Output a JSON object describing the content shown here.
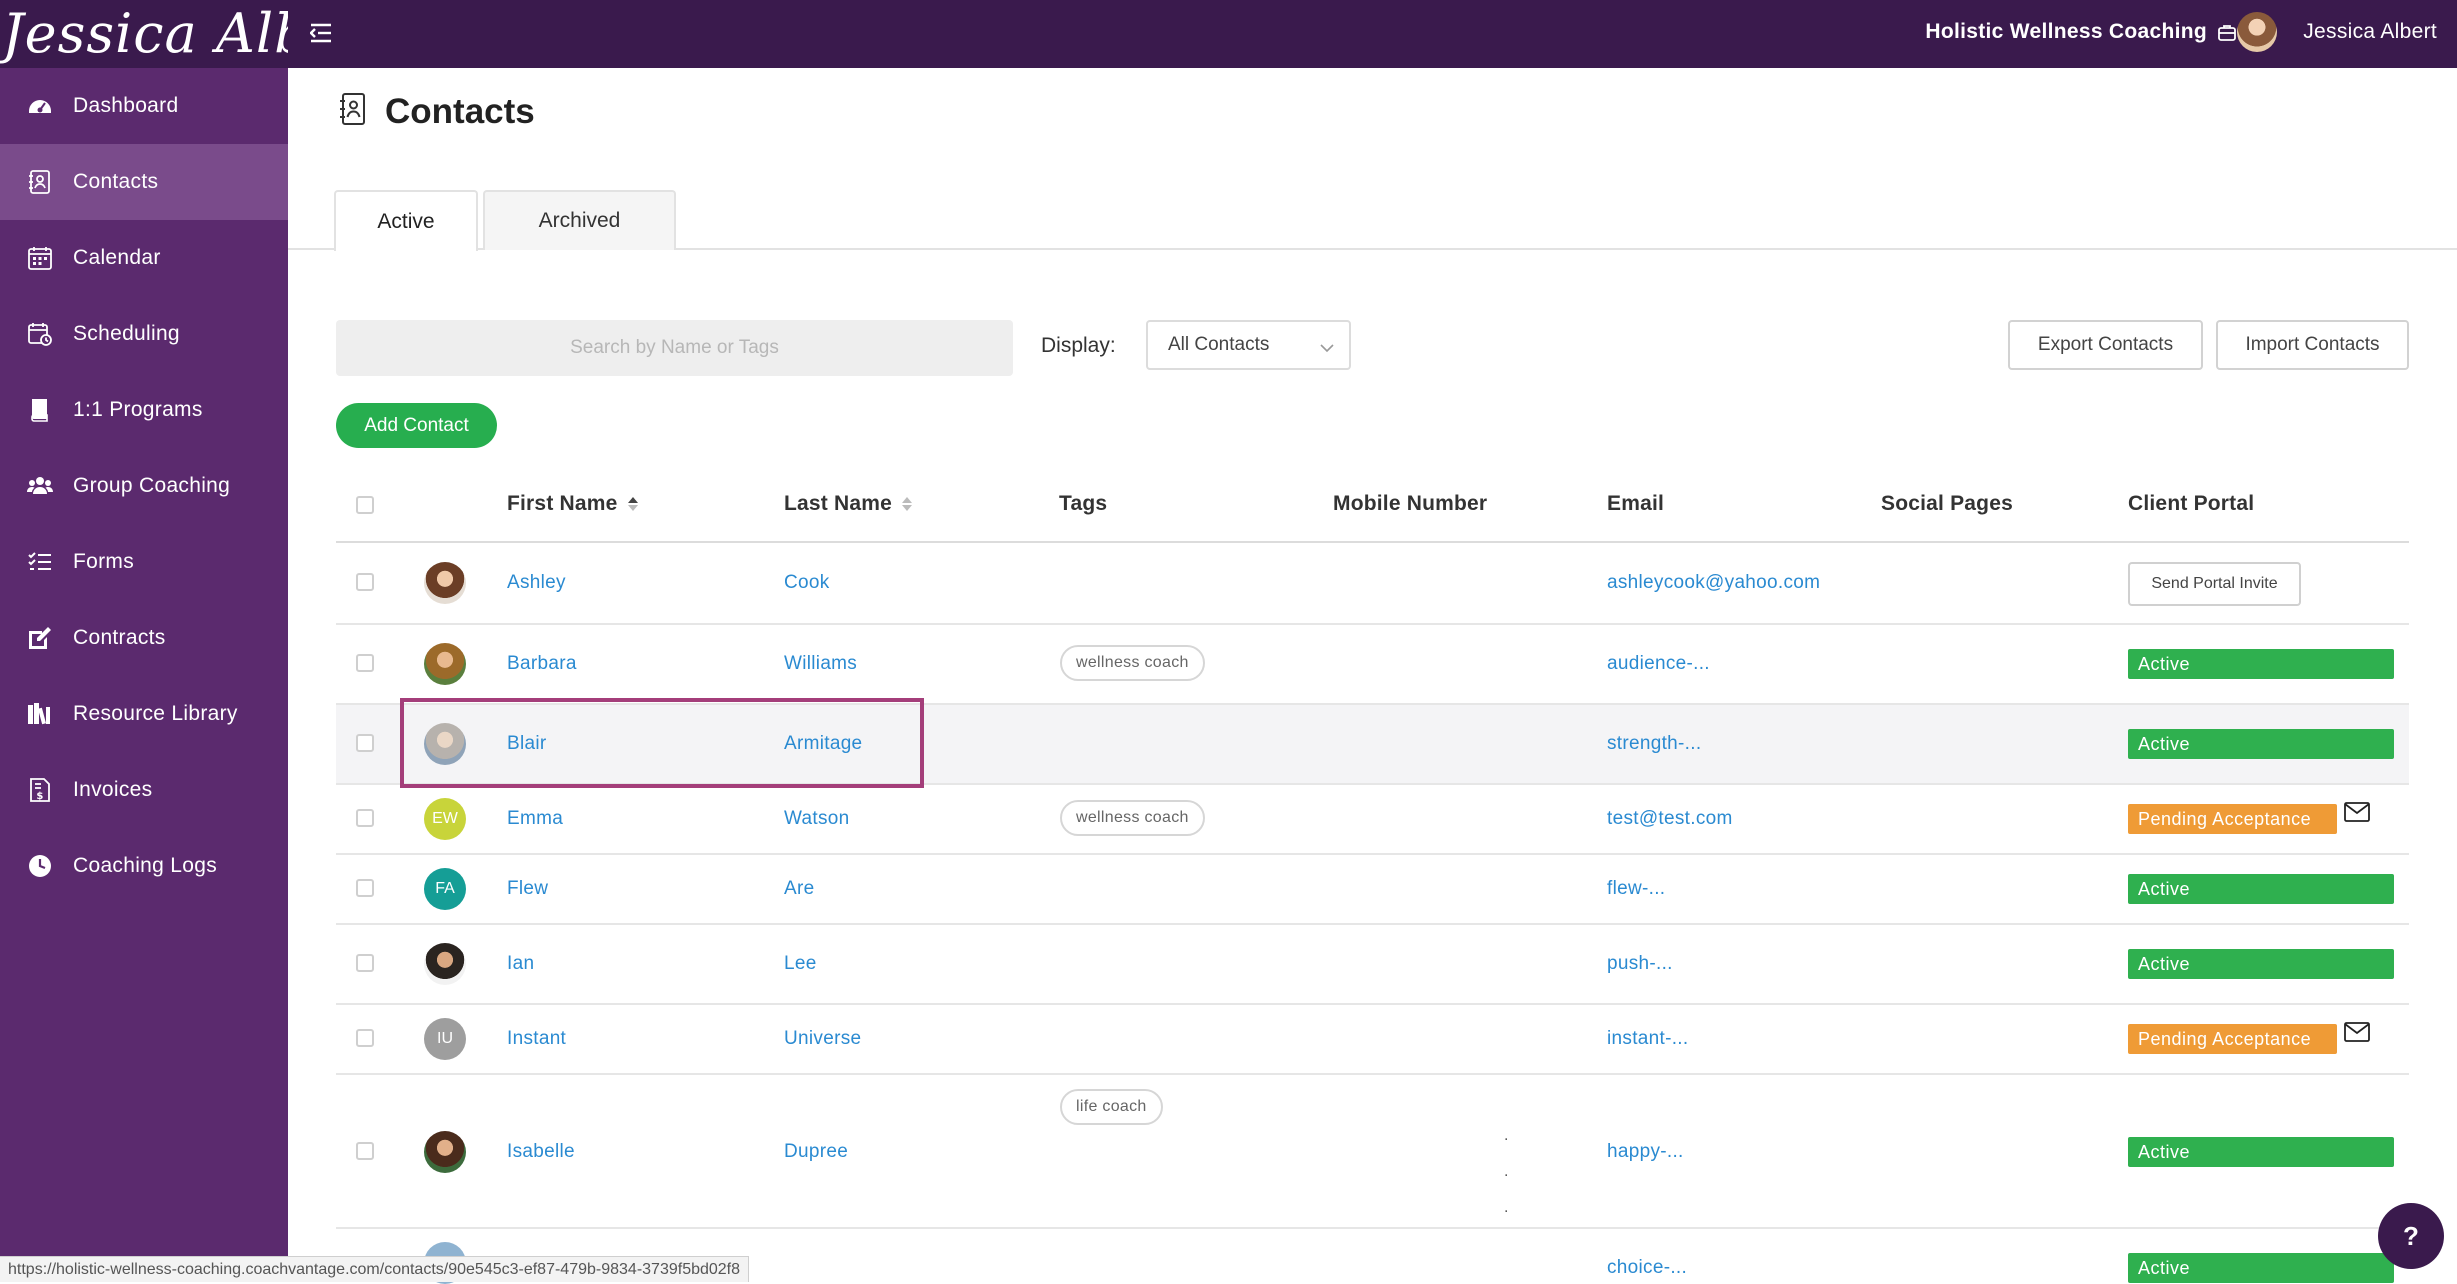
{
  "header": {
    "logo_text": "Jessica Albert",
    "business_name": "Holistic Wellness Coaching",
    "user_name": "Jessica Albert"
  },
  "sidebar": {
    "items": [
      {
        "label": "Dashboard",
        "icon": "dashboard-icon"
      },
      {
        "label": "Contacts",
        "icon": "contacts-icon",
        "active": true
      },
      {
        "label": "Calendar",
        "icon": "calendar-icon"
      },
      {
        "label": "Scheduling",
        "icon": "scheduling-icon"
      },
      {
        "label": "1:1 Programs",
        "icon": "programs-icon"
      },
      {
        "label": "Group Coaching",
        "icon": "group-icon"
      },
      {
        "label": "Forms",
        "icon": "forms-icon"
      },
      {
        "label": "Contracts",
        "icon": "contracts-icon"
      },
      {
        "label": "Resource Library",
        "icon": "library-icon"
      },
      {
        "label": "Invoices",
        "icon": "invoices-icon"
      },
      {
        "label": "Coaching Logs",
        "icon": "clock-icon"
      }
    ]
  },
  "page": {
    "title": "Contacts",
    "tabs": [
      "Active",
      "Archived"
    ],
    "search_placeholder": "Search by Name or Tags",
    "display_label": "Display:",
    "display_value": "All Contacts",
    "export_label": "Export Contacts",
    "import_label": "Import Contacts",
    "add_label": "Add Contact"
  },
  "table": {
    "columns": [
      "First Name",
      "Last Name",
      "Tags",
      "Mobile Number",
      "Email",
      "Social Pages",
      "Client Portal"
    ],
    "rows": [
      {
        "first": "Ashley",
        "last": "Cook",
        "tag": "",
        "email": "ashleycook@yahoo.com",
        "portal": "Send Portal Invite",
        "initials": ""
      },
      {
        "first": "Barbara",
        "last": "Williams",
        "tag": "wellness coach",
        "email": "audience-...",
        "portal": "Active",
        "initials": ""
      },
      {
        "first": "Blair",
        "last": "Armitage",
        "tag": "",
        "email": "strength-...",
        "portal": "Active",
        "initials": ""
      },
      {
        "first": "Emma",
        "last": "Watson",
        "tag": "wellness coach",
        "email": "test@test.com",
        "portal": "Pending Acceptance",
        "initials": "EW"
      },
      {
        "first": "Flew",
        "last": "Are",
        "tag": "",
        "email": "flew-...",
        "portal": "Active",
        "initials": "FA"
      },
      {
        "first": "Ian",
        "last": "Lee",
        "tag": "",
        "email": "push-...",
        "portal": "Active",
        "initials": ""
      },
      {
        "first": "Instant",
        "last": "Universe",
        "tag": "",
        "email": "instant-...",
        "portal": "Pending Acceptance",
        "initials": "IU"
      },
      {
        "first": "Isabelle",
        "last": "Dupree",
        "tag": "life coach",
        "email": "happy-...",
        "portal": "Active",
        "initials": ""
      },
      {
        "first": "",
        "last": "",
        "tag": "",
        "email": "choice-...",
        "portal": "Active",
        "initials": ""
      }
    ]
  },
  "status_bar": {
    "url": "https://holistic-wellness-coaching.coachvantage.com/contacts/90e545c3-ef87-479b-9834-3739f5bd02f8"
  },
  "help": {
    "label": "?"
  },
  "colors": {
    "topbar": "#3a1a4d",
    "sidebar": "#5b2a6e",
    "link": "#2a8ad1",
    "active_badge": "#2fb04f",
    "pending_badge": "#ef9b36",
    "add_button": "#27ae4f",
    "highlight_box": "#a43e7a"
  }
}
